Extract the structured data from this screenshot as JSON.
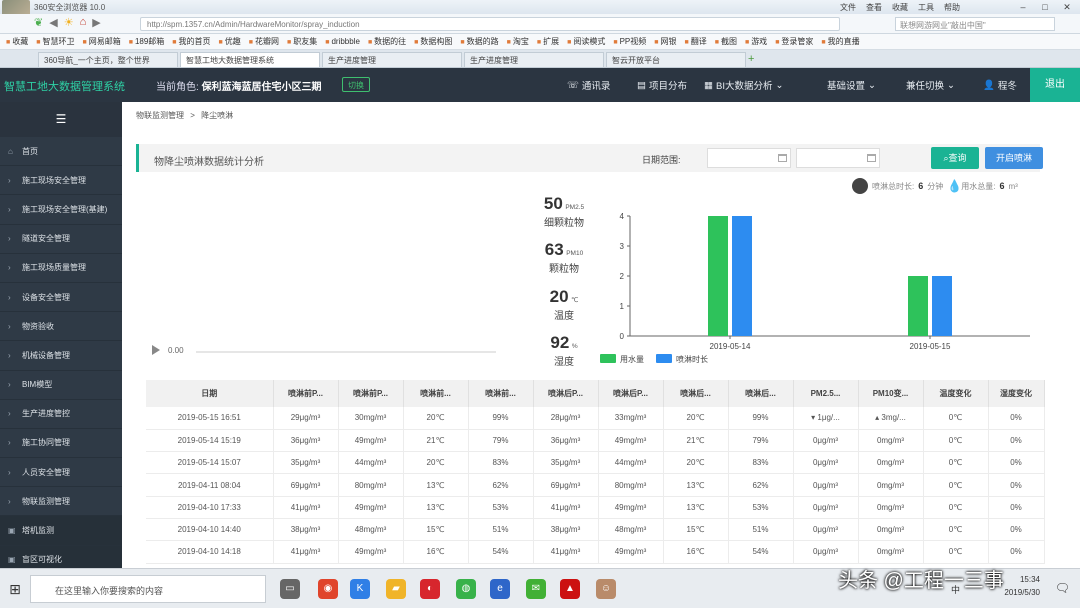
{
  "browser": {
    "title": "360安全浏览器 10.0",
    "menus": [
      "文件",
      "查看",
      "收藏",
      "工具",
      "帮助"
    ],
    "url": "http://spm.1357.cn/Admin/HardwareMonitor/spray_induction",
    "search_placeholder": "联想网游网业\"敲出中国\"",
    "bookmarks": [
      "收藏",
      "智慧环卫",
      "网易邮箱",
      "189邮箱",
      "我的首页",
      "优趣",
      "花瓣网",
      "职友集",
      "dribbble",
      "数据的往",
      "数据构图",
      "数据的路",
      "淘宝",
      "扩展",
      "阅读模式",
      "PP视频",
      "网银",
      "翻译",
      "截图",
      "游戏",
      "登录管家",
      "我的直播"
    ],
    "tabs": [
      "360导航_一个主页，整个世界",
      "智慧工地大数据管理系统",
      "生产进度管理",
      "生产进度管理",
      "智云开放平台"
    ],
    "active_tab": 1
  },
  "app": {
    "logo": "智慧工地大数据管理系统",
    "role_label": "当前角色:",
    "role_value": "保利蓝海蓝居住宅小区三期",
    "switch": "切换",
    "nav": [
      "通讯录",
      "项目分布",
      "BI大数据分析",
      "基础设置",
      "兼任切换",
      "程冬"
    ],
    "exit": "退出"
  },
  "sidebar": {
    "toggle_icon": "hamburger-icon",
    "items": [
      "首页",
      "施工现场安全管理",
      "施工现场安全管理(基建)",
      "隧道安全管理",
      "施工现场质量管理",
      "设备安全管理",
      "物资验收",
      "机械设备管理",
      "BIM模型",
      "生产进度管控",
      "施工协同管理",
      "人员安全管理",
      "物联监测管理",
      "塔机监测",
      "盲区可视化"
    ]
  },
  "breadcrumb": {
    "parent": "物联监测管理",
    "sep": ">",
    "current": "降尘喷淋"
  },
  "panel": {
    "title": "物降尘喷淋数据统计分析",
    "date_label": "日期范围:",
    "query": "查询",
    "spray": "开启喷淋"
  },
  "stats": [
    {
      "value": "50",
      "unit": "PM2.5",
      "label": "细颗粒物"
    },
    {
      "value": "63",
      "unit": "PM10",
      "label": "颗粒物"
    },
    {
      "value": "20",
      "unit": "℃",
      "label": "温度"
    },
    {
      "value": "92",
      "unit": "%",
      "label": "湿度"
    }
  ],
  "totals": {
    "spray_total_label": "喷淋总时长:",
    "spray_total_value": "6",
    "spray_total_unit": "分钟",
    "water_total_label": "用水总量:",
    "water_total_value": "6",
    "water_total_unit": "m³"
  },
  "audio": {
    "time": "0.00"
  },
  "chart_data": {
    "type": "bar",
    "categories": [
      "2019-05-14",
      "2019-05-15"
    ],
    "series": [
      {
        "name": "用水量",
        "values": [
          4,
          2
        ],
        "color": "#2ec25b"
      },
      {
        "name": "喷淋时长",
        "values": [
          4,
          2
        ],
        "color": "#2d8cf0"
      }
    ],
    "ylim": [
      0,
      4
    ],
    "yticks": [
      0,
      1,
      2,
      3,
      4
    ],
    "legend": "bottom-left"
  },
  "table": {
    "headers": [
      "日期",
      "喷淋前P...",
      "喷淋前P...",
      "喷淋前...",
      "喷淋前...",
      "喷淋后P...",
      "喷淋后P...",
      "喷淋后...",
      "喷淋后...",
      "PM2.5...",
      "PM10变...",
      "温度变化",
      "湿度变化"
    ],
    "rows": [
      [
        "2019-05-15 16:51",
        "29μg/m³",
        "30mg/m³",
        "20℃",
        "99%",
        "28μg/m³",
        "33mg/m³",
        "20℃",
        "99%",
        "▾ 1μg/...",
        "▴ 3mg/...",
        "0℃",
        "0%"
      ],
      [
        "2019-05-14 15:19",
        "36μg/m³",
        "49mg/m³",
        "21℃",
        "79%",
        "36μg/m³",
        "49mg/m³",
        "21℃",
        "79%",
        "0μg/m³",
        "0mg/m³",
        "0℃",
        "0%"
      ],
      [
        "2019-05-14 15:07",
        "35μg/m³",
        "44mg/m³",
        "20℃",
        "83%",
        "35μg/m³",
        "44mg/m³",
        "20℃",
        "83%",
        "0μg/m³",
        "0mg/m³",
        "0℃",
        "0%"
      ],
      [
        "2019-04-11 08:04",
        "69μg/m³",
        "80mg/m³",
        "13℃",
        "62%",
        "69μg/m³",
        "80mg/m³",
        "13℃",
        "62%",
        "0μg/m³",
        "0mg/m³",
        "0℃",
        "0%"
      ],
      [
        "2019-04-10 17:33",
        "41μg/m³",
        "49mg/m³",
        "13℃",
        "53%",
        "41μg/m³",
        "49mg/m³",
        "13℃",
        "53%",
        "0μg/m³",
        "0mg/m³",
        "0℃",
        "0%"
      ],
      [
        "2019-04-10 14:40",
        "38μg/m³",
        "48mg/m³",
        "15℃",
        "51%",
        "38μg/m³",
        "48mg/m³",
        "15℃",
        "51%",
        "0μg/m³",
        "0mg/m³",
        "0℃",
        "0%"
      ],
      [
        "2019-04-10 14:18",
        "41μg/m³",
        "49mg/m³",
        "16℃",
        "54%",
        "41μg/m³",
        "49mg/m³",
        "16℃",
        "54%",
        "0μg/m³",
        "0mg/m³",
        "0℃",
        "0%"
      ]
    ]
  },
  "taskbar": {
    "search_placeholder": "在这里输入你要搜索的内容",
    "time": "15:34",
    "date": "2019/5/30",
    "input_lang": "中"
  },
  "watermark": "头条 @工程一三事"
}
